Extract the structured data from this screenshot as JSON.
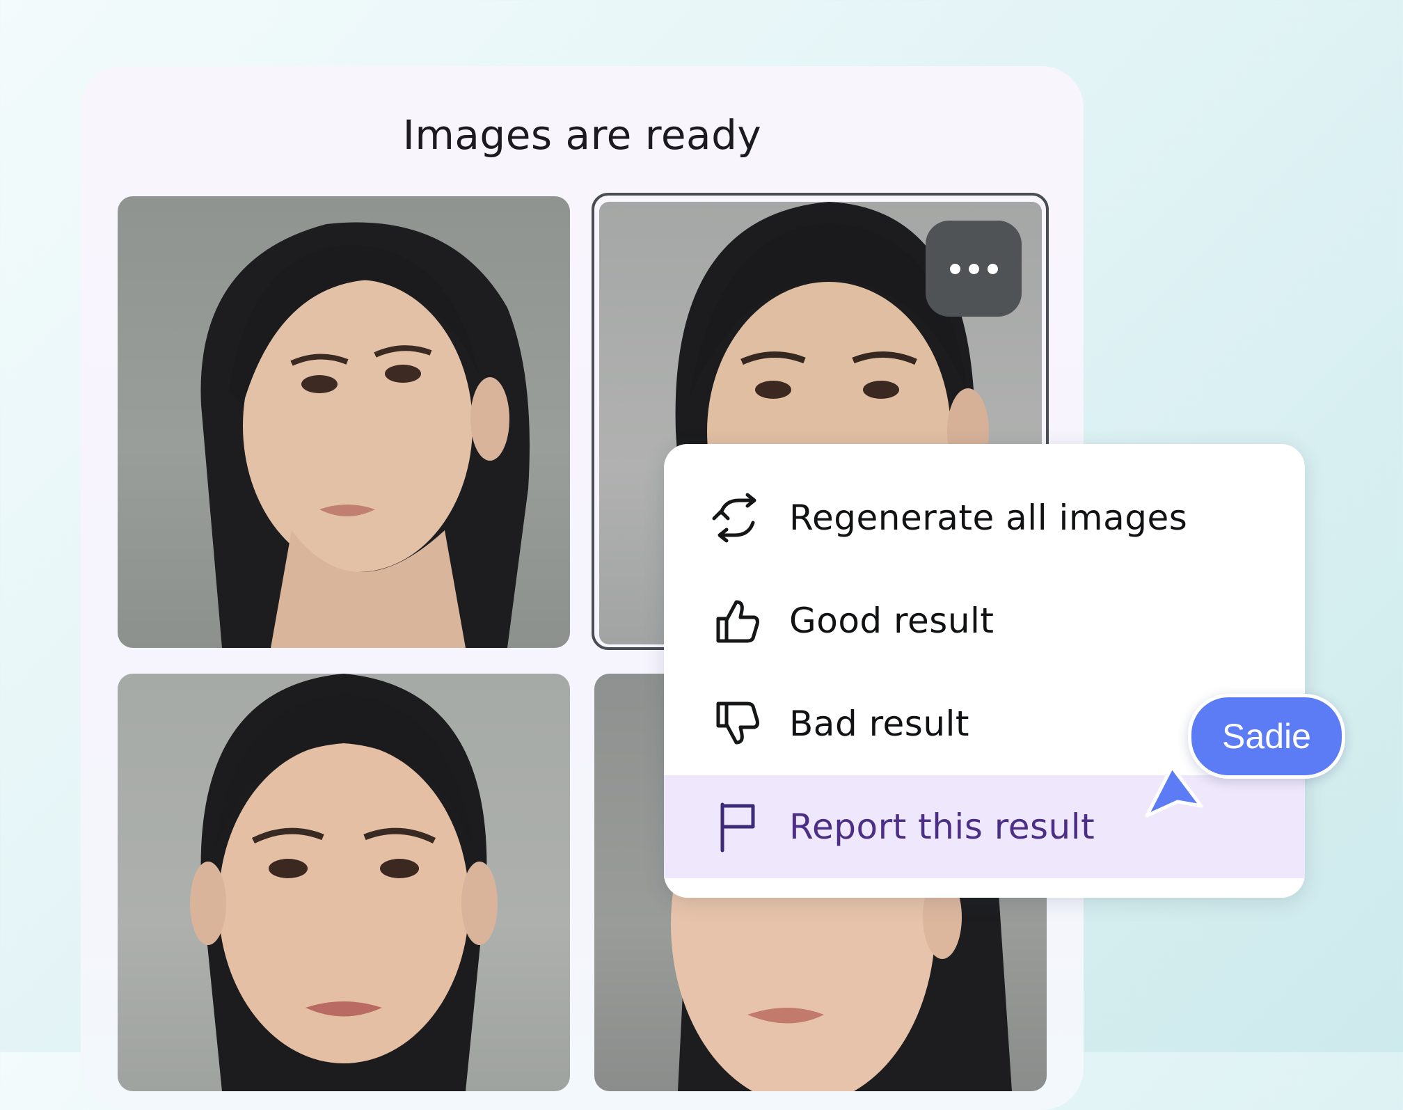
{
  "panel": {
    "title": "Images are ready"
  },
  "images": [
    {
      "name": "generated-image-1"
    },
    {
      "name": "generated-image-2",
      "selected": true
    },
    {
      "name": "generated-image-3"
    },
    {
      "name": "generated-image-4"
    }
  ],
  "more_button": {
    "icon": "more-horizontal-icon"
  },
  "menu": {
    "items": [
      {
        "label": "Regenerate all images",
        "icon": "regenerate-icon"
      },
      {
        "label": "Good result",
        "icon": "thumbs-up-icon"
      },
      {
        "label": "Bad result",
        "icon": "thumbs-down-icon"
      },
      {
        "label": "Report this result",
        "icon": "flag-icon",
        "highlighted": true
      }
    ]
  },
  "cursor": {
    "user": "Sadie",
    "color": "#5b7cf4"
  },
  "colors": {
    "accent": "#5b7cf4",
    "highlight_bg": "#efe7fb",
    "highlight_text": "#4b2f86"
  }
}
